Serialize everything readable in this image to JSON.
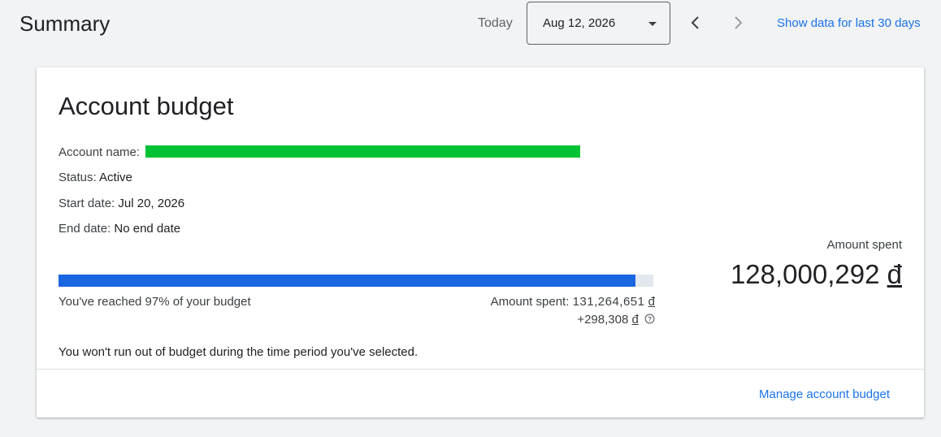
{
  "header": {
    "title": "Summary",
    "today_label": "Today",
    "date_value": "Aug 12, 2026",
    "show_30_link": "Show data for last 30 days"
  },
  "card": {
    "title": "Account budget",
    "account_name_label": "Account name:",
    "status_label": "Status:",
    "status_value": "Active",
    "start_label": "Start date:",
    "start_value": "Jul 20, 2026",
    "end_label": "End date:",
    "end_value": "No end date",
    "progress_fraction": 0.97,
    "reached_text": "You've reached 97% of your budget",
    "spent_inline_label": "Amount spent:",
    "spent_inline_value": "131,264,651",
    "delta_value": "+298,308",
    "currency_symbol": "đ",
    "amount_spent_label": "Amount spent",
    "amount_spent_value": "128,000,292",
    "budget_note": "You won't run out of budget during the time period you've selected.",
    "manage_link": "Manage account budget"
  },
  "colors": {
    "accent": "#1a73e8",
    "progress_fill": "#1a66e0",
    "progress_track": "#e3e8ee",
    "redaction": "#00c234"
  },
  "icons": {
    "dropdown": "chevron-down-icon",
    "prev": "chevron-left-icon",
    "next": "chevron-right-icon",
    "help": "help-circle-icon"
  }
}
